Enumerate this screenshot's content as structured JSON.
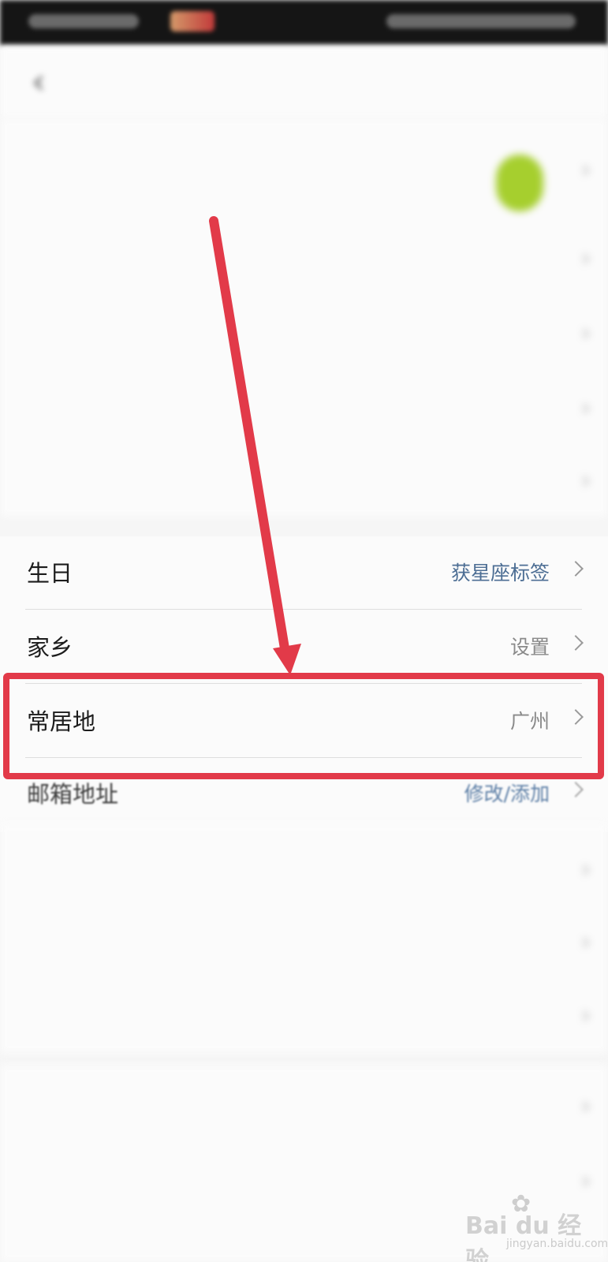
{
  "rows": [
    {
      "label": "生日",
      "value": "获星座标签"
    },
    {
      "label": "家乡",
      "value": "设置"
    },
    {
      "label": "常居地",
      "value": "广州"
    },
    {
      "label": "邮箱地址",
      "value": "修改/添加"
    }
  ],
  "icons": {
    "back": "back-icon",
    "chevron": "chevron-right-icon"
  },
  "colors": {
    "annotation": "#e23a49",
    "value_link": "#4d6e94",
    "value_plain": "#8a8a8a",
    "avatar": "#a6cf2e"
  },
  "watermark": {
    "brand": "Bai du 经验",
    "url": "jingyan.baidu.com"
  }
}
